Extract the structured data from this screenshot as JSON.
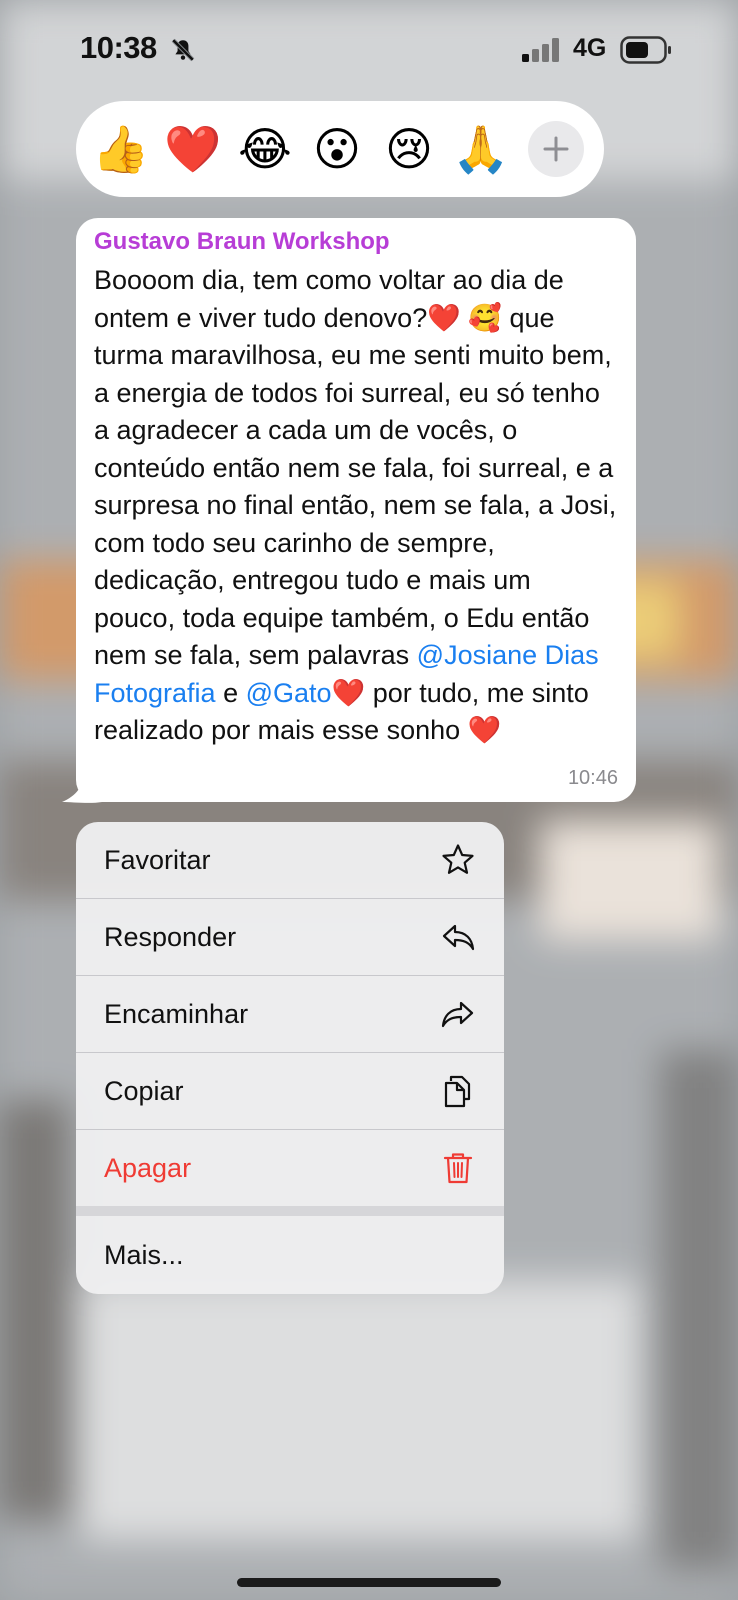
{
  "status_bar": {
    "time": "10:38",
    "network": "4G",
    "icons": [
      "bell-slash-icon",
      "signal-icon",
      "battery-icon"
    ]
  },
  "reactions": {
    "emojis": [
      "👍",
      "❤️",
      "😂",
      "😮",
      "😢",
      "🙏"
    ],
    "more_icon": "plus-icon"
  },
  "message": {
    "sender": "Gustavo Braun Workshop",
    "text_before": "Boooom dia, tem como voltar ao dia de ontem e viver tudo denovo?",
    "emoji_1": "❤️",
    "emoji_2": "🥰",
    "text_middle": " que turma maravilhosa, eu me senti muito bem, a energia de todos foi surreal, eu só tenho a agradecer a cada um de vocês, o conteúdo então nem se fala, foi surreal, e a surpresa no final então, nem se fala, a Josi, com todo seu carinho de sempre, dedicação, entregou tudo e mais um pouco, toda equipe também, o Edu então nem se fala, sem palavras ",
    "mention_1": "@Josiane Dias Fotografia",
    "connector": " e ",
    "mention_2": "@Gato",
    "emoji_3": "❤️",
    "text_after": " por tudo, me sinto realizado por mais esse sonho ",
    "emoji_4": "❤️",
    "time": "10:46",
    "colors": {
      "sender": "#b73dd6",
      "mention": "#1a7ff0"
    }
  },
  "menu": {
    "items": [
      {
        "label": "Favoritar",
        "icon": "star-icon"
      },
      {
        "label": "Responder",
        "icon": "reply-icon"
      },
      {
        "label": "Encaminhar",
        "icon": "forward-icon"
      },
      {
        "label": "Copiar",
        "icon": "copy-icon"
      },
      {
        "label": "Apagar",
        "icon": "trash-icon",
        "color": "#ef3b34"
      },
      {
        "label": "Mais..."
      }
    ]
  }
}
